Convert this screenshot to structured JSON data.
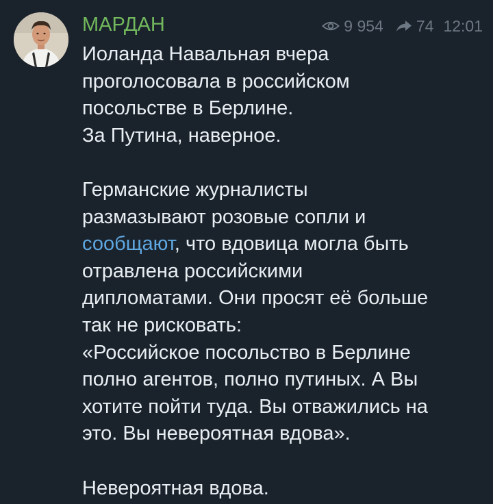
{
  "channel": {
    "name": "МАРДАН",
    "views": "9 954",
    "forwards": "74",
    "time": "12:01"
  },
  "message": {
    "p1": [
      "Иоланда Навальная вчера",
      "проголосовала в российском",
      "посольстве в Берлине.",
      "За Путина, наверное."
    ],
    "p2": {
      "line1": "Германские журналисты",
      "line2": "размазывают розовые сопли и",
      "link": "сообщают",
      "line3_rest": ", что вдовица могла быть",
      "line4": "отравлена российскими",
      "line5": "дипломатами. Они просят её больше",
      "line6": "так не рисковать:",
      "line7": "«Российское посольство в Берлине",
      "line8": "полно агентов, полно путиных. А Вы",
      "line9": "хотите пойти туда. Вы отважились на",
      "line10": "это. Вы невероятная вдова»."
    },
    "p3": "Невероятная вдова."
  },
  "colors": {
    "background": "#1a222c",
    "channel_name": "#72b85d",
    "meta": "#6c7883",
    "text": "#e9eef2",
    "link": "#5fa7e0"
  },
  "icons": {
    "views": "eye-icon",
    "forwards": "share-arrow-icon"
  }
}
